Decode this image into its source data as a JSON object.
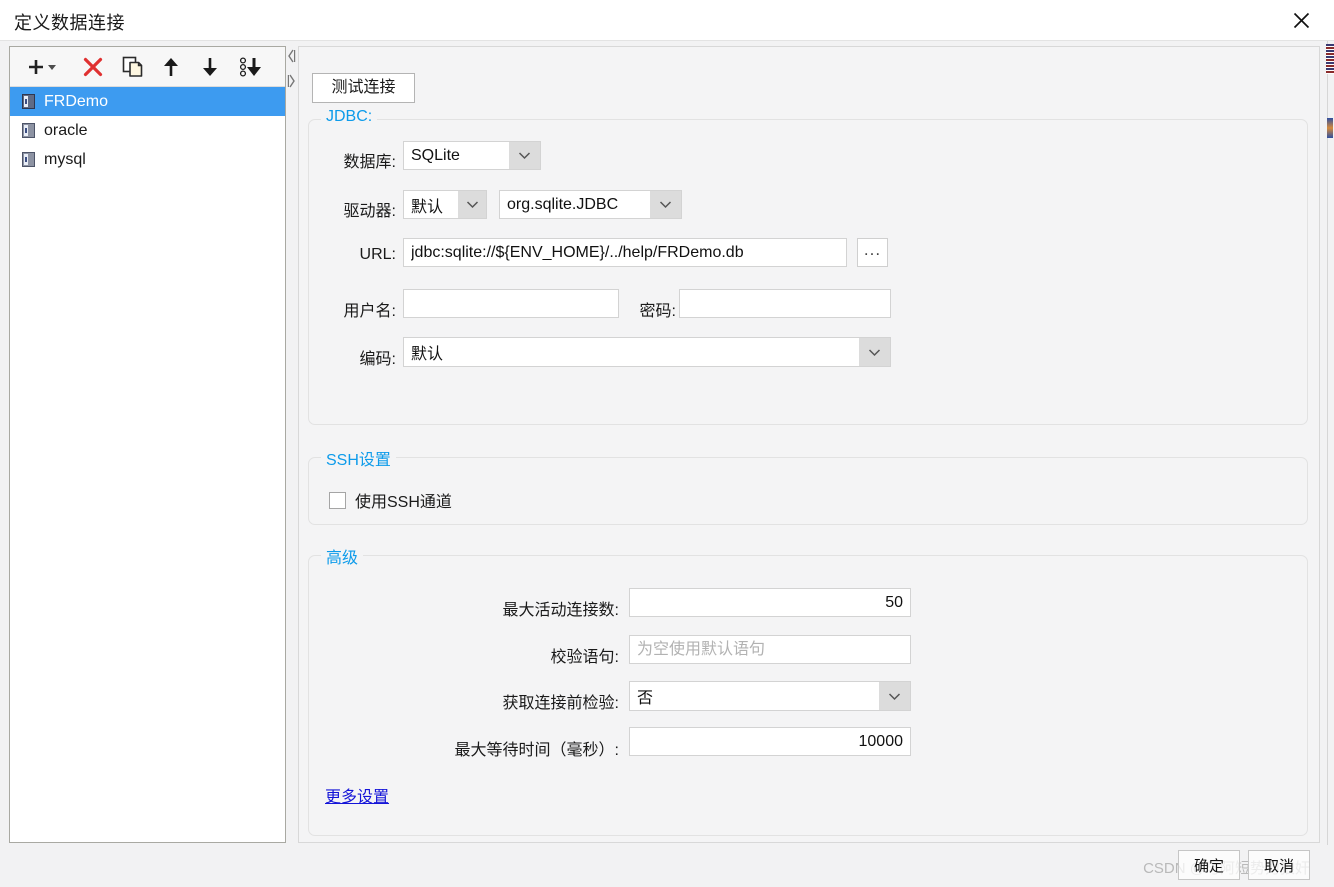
{
  "window": {
    "title": "定义数据连接",
    "close_icon": "close-icon"
  },
  "toolbar": {
    "add_label": "add-with-dropdown",
    "delete_label": "delete",
    "copy_label": "copy",
    "move_up_label": "move-up",
    "move_down_label": "move-down",
    "sort_label": "sort-descending"
  },
  "connection_list": {
    "items": [
      {
        "name": "FRDemo",
        "selected": true
      },
      {
        "name": "oracle",
        "selected": false
      },
      {
        "name": "mysql",
        "selected": false
      }
    ]
  },
  "right_panel": {
    "test_button": "测试连接",
    "jdbc": {
      "legend": "JDBC:",
      "database_label": "数据库:",
      "database_value": "SQLite",
      "driver_label": "驱动器:",
      "driver_mode_value": "默认",
      "driver_class_value": "org.sqlite.JDBC",
      "url_label": "URL:",
      "url_value": "jdbc:sqlite://${ENV_HOME}/../help/FRDemo.db",
      "url_browse_label": "...",
      "username_label": "用户名:",
      "username_value": "",
      "password_label": "密码:",
      "password_value": "",
      "charset_label": "编码:",
      "charset_value": "默认"
    },
    "ssh": {
      "legend": "SSH设置",
      "use_ssh_label": "使用SSH通道",
      "use_ssh_checked": false
    },
    "advanced": {
      "legend": "高级",
      "max_active_label": "最大活动连接数:",
      "max_active_value": "50",
      "validation_label": "校验语句:",
      "validation_value": "",
      "validation_placeholder": "为空使用默认语句",
      "test_before_label": "获取连接前检验:",
      "test_before_value": "否",
      "max_wait_label": "最大等待时间（毫秒）:",
      "max_wait_value": "10000",
      "more_settings_link": "更多设置"
    }
  },
  "footer": {
    "ok_label": "确定",
    "cancel_label": "取消",
    "watermark": "CSDN @与阿短势力狼奸"
  },
  "colors": {
    "accent_legend": "#0d9bea",
    "selection": "#3d9bf0",
    "link": "#1414d8",
    "delete_icon": "#e03131"
  }
}
